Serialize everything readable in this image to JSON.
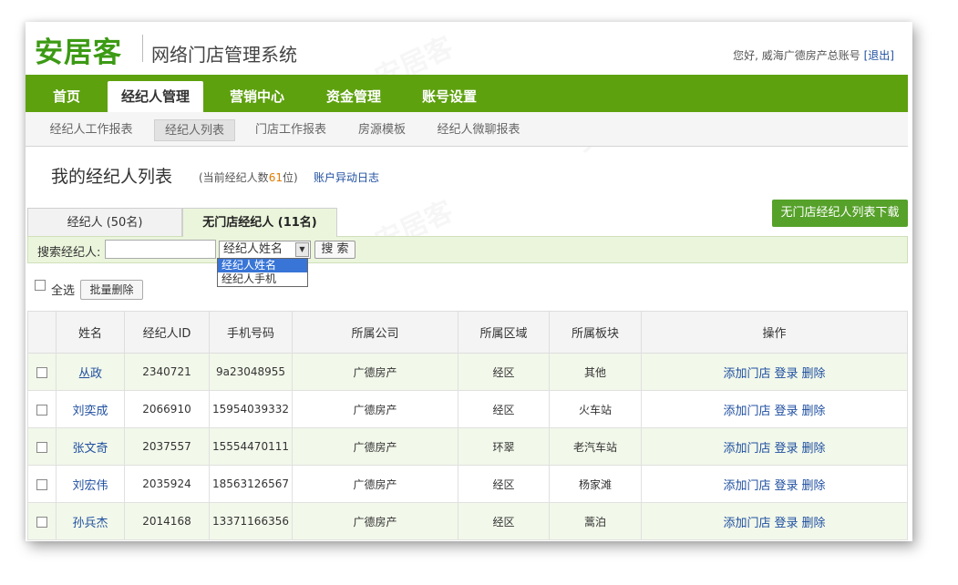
{
  "header": {
    "logo_text": "安居客",
    "system_title": "网络门店管理系统",
    "greeting": "您好, 威海广德房产总账号",
    "logout_label": "[退出]"
  },
  "main_nav": {
    "tabs": [
      "首页",
      "经纪人管理",
      "营销中心",
      "资金管理",
      "账号设置"
    ],
    "active": "经纪人管理"
  },
  "sub_nav": {
    "items": [
      "经纪人工作报表",
      "经纪人列表",
      "门店工作报表",
      "房源模板",
      "经纪人微聊报表"
    ],
    "active": "经纪人列表"
  },
  "page": {
    "title": "我的经纪人列表",
    "count_prefix": "(当前经纪人数",
    "count_value": "61",
    "count_suffix": "位)",
    "account_log_link": "账户异动日志",
    "download_button": "无门店经纪人列表下载"
  },
  "list_tabs": [
    {
      "label": "经纪人 (50名)",
      "active": false
    },
    {
      "label": "无门店经纪人 (11名)",
      "active": true
    }
  ],
  "search": {
    "label": "搜索经纪人:",
    "input_value": "",
    "select_value": "经纪人姓名",
    "button_label": "搜 索",
    "dropdown_options": [
      "经纪人姓名",
      "经纪人手机"
    ]
  },
  "bulk": {
    "select_all_label": "全选",
    "batch_delete_label": "批量删除"
  },
  "table": {
    "headers": [
      "",
      "姓名",
      "经纪人ID",
      "手机号码",
      "所属公司",
      "所属区域",
      "所属板块",
      "操作"
    ],
    "operations": [
      "添加门店",
      "登录",
      "删除"
    ],
    "rows": [
      {
        "name": "丛政",
        "id": "2340721",
        "phone": "9a23048955",
        "company": "广德房产",
        "region": "经区",
        "block": "其他"
      },
      {
        "name": "刘奕成",
        "id": "2066910",
        "phone": "15954039332",
        "company": "广德房产",
        "region": "经区",
        "block": "火车站"
      },
      {
        "name": "张文奇",
        "id": "2037557",
        "phone": "15554470111",
        "company": "广德房产",
        "region": "环翠",
        "block": "老汽车站"
      },
      {
        "name": "刘宏伟",
        "id": "2035924",
        "phone": "18563126567",
        "company": "广德房产",
        "region": "经区",
        "block": "杨家滩"
      },
      {
        "name": "孙兵杰",
        "id": "2014168",
        "phone": "13371166356",
        "company": "广德房产",
        "region": "经区",
        "block": "蒿泊"
      }
    ]
  },
  "colors": {
    "brand_green": "#5ea10f",
    "logo_green": "#3c9a14",
    "link_blue": "#1f4fa0",
    "row_highlight": "#f2f8ea"
  }
}
